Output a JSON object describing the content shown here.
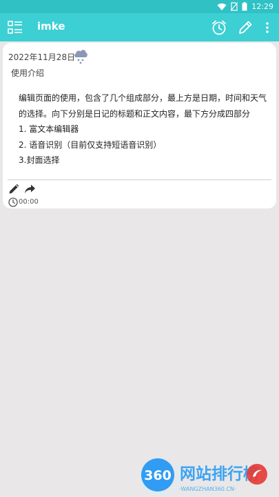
{
  "statusbar": {
    "time": "12:29"
  },
  "appbar": {
    "title": "imke",
    "icons": [
      "list-menu-icon",
      "alarm-clock-icon",
      "edit-pencil-icon",
      "more-vert-icon"
    ]
  },
  "entry": {
    "date": "2022年11月28日",
    "weather_icon": "snow-cloud-icon",
    "title": "使用介绍",
    "body": [
      "编辑页面的使用，包含了几个组成部分，最上方是日期，时间和天气的选择。向下分别是日记的标题和正文内容，最下方分成四部分",
      "1. 富文本编辑器",
      "2. 语音识别（目前仅支持短语音识别）",
      "3.封面选择"
    ],
    "time": "00:00"
  },
  "watermark": {
    "badge": "360",
    "text": "网站排行榜",
    "subtext": "·WANGZHAN360.CN·"
  },
  "colors": {
    "statusbar": "#2fc1c4",
    "appbar": "#3ccfd3",
    "background": "#e9e7e8",
    "card": "#ffffff",
    "weather": "#8b97b4",
    "watermark_blue": "#2196f3",
    "watermark_red": "#e53935"
  }
}
